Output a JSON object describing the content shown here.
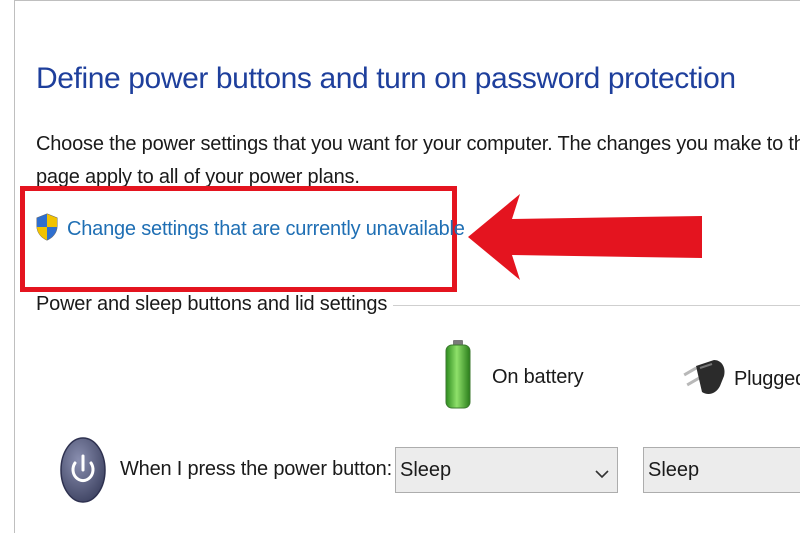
{
  "page": {
    "title": "Define power buttons and turn on password protection",
    "description_line1": "Choose the power settings that you want for your computer. The changes you make to the settin",
    "description_line2": "page apply to all of your power plans.",
    "uac_link_label": "Change settings that are currently unavailable",
    "section_label": "Power and sleep buttons and lid settings",
    "columns": {
      "battery_label": "On battery",
      "plugged_label": "Plugged"
    },
    "rows": [
      {
        "label": "When I press the power button:",
        "battery_value": "Sleep",
        "plugged_value": "Sleep"
      }
    ]
  },
  "colors": {
    "title": "#1e3f9c",
    "link": "#1f6fb4",
    "highlight_annotation": "#e4141f"
  },
  "icons": {
    "uac": "shield-icon",
    "battery": "battery-icon",
    "plug": "plug-icon",
    "power": "power-icon",
    "dropdown": "chevron-down-icon",
    "annotation": "arrow-left-icon"
  }
}
